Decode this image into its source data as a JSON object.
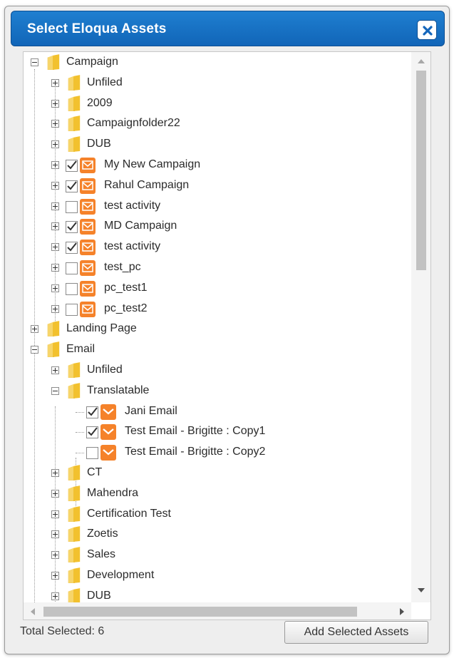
{
  "dialog": {
    "title": "Select Eloqua Assets",
    "close_icon": "close-icon",
    "title_bar_color": "#1670c4"
  },
  "tree": [
    {
      "label": "Campaign",
      "type": "folder",
      "level": 0,
      "expander": "minus"
    },
    {
      "label": "Unfiled",
      "type": "folder",
      "level": 1,
      "expander": "plus"
    },
    {
      "label": "2009",
      "type": "folder",
      "level": 1,
      "expander": "plus"
    },
    {
      "label": "Campaignfolder22",
      "type": "folder",
      "level": 1,
      "expander": "plus"
    },
    {
      "label": "DUB",
      "type": "folder",
      "level": 1,
      "expander": "plus"
    },
    {
      "label": "My New Campaign",
      "type": "campaign",
      "level": 1,
      "expander": "plus",
      "checked": true
    },
    {
      "label": "Rahul Campaign",
      "type": "campaign",
      "level": 1,
      "expander": "plus",
      "checked": true
    },
    {
      "label": "test activity",
      "type": "campaign",
      "level": 1,
      "expander": "plus",
      "checked": false
    },
    {
      "label": "MD Campaign",
      "type": "campaign",
      "level": 1,
      "expander": "plus",
      "checked": true
    },
    {
      "label": "test activity",
      "type": "campaign",
      "level": 1,
      "expander": "plus",
      "checked": true
    },
    {
      "label": "test_pc",
      "type": "campaign",
      "level": 1,
      "expander": "plus",
      "checked": false
    },
    {
      "label": "pc_test1",
      "type": "campaign",
      "level": 1,
      "expander": "plus",
      "checked": false
    },
    {
      "label": "pc_test2",
      "type": "campaign",
      "level": 1,
      "expander": "plus",
      "checked": false
    },
    {
      "label": "Landing Page",
      "type": "folder",
      "level": 0,
      "expander": "plus"
    },
    {
      "label": "Email",
      "type": "folder",
      "level": 0,
      "expander": "minus"
    },
    {
      "label": "Unfiled",
      "type": "folder",
      "level": 1,
      "expander": "plus"
    },
    {
      "label": "Translatable",
      "type": "folder",
      "level": 1,
      "expander": "minus"
    },
    {
      "label": "Jani Email",
      "type": "email",
      "level": 2,
      "checked": true
    },
    {
      "label": "Test Email - Brigitte : Copy1",
      "type": "email",
      "level": 2,
      "checked": true
    },
    {
      "label": "Test Email - Brigitte : Copy2",
      "type": "email",
      "level": 2,
      "checked": false
    },
    {
      "label": "CT",
      "type": "folder",
      "level": 1,
      "expander": "plus"
    },
    {
      "label": "Mahendra",
      "type": "folder",
      "level": 1,
      "expander": "plus"
    },
    {
      "label": "Certification Test",
      "type": "folder",
      "level": 1,
      "expander": "plus"
    },
    {
      "label": "Zoetis",
      "type": "folder",
      "level": 1,
      "expander": "plus"
    },
    {
      "label": "Sales",
      "type": "folder",
      "level": 1,
      "expander": "plus"
    },
    {
      "label": "Development",
      "type": "folder",
      "level": 1,
      "expander": "plus"
    },
    {
      "label": "DUB",
      "type": "folder",
      "level": 1,
      "expander": "plus"
    }
  ],
  "footer": {
    "total_selected": "Total Selected: 6",
    "add_button": "Add Selected Assets"
  },
  "colors": {
    "asset_icon": "#f5822a",
    "folder": "#f2c12e"
  }
}
